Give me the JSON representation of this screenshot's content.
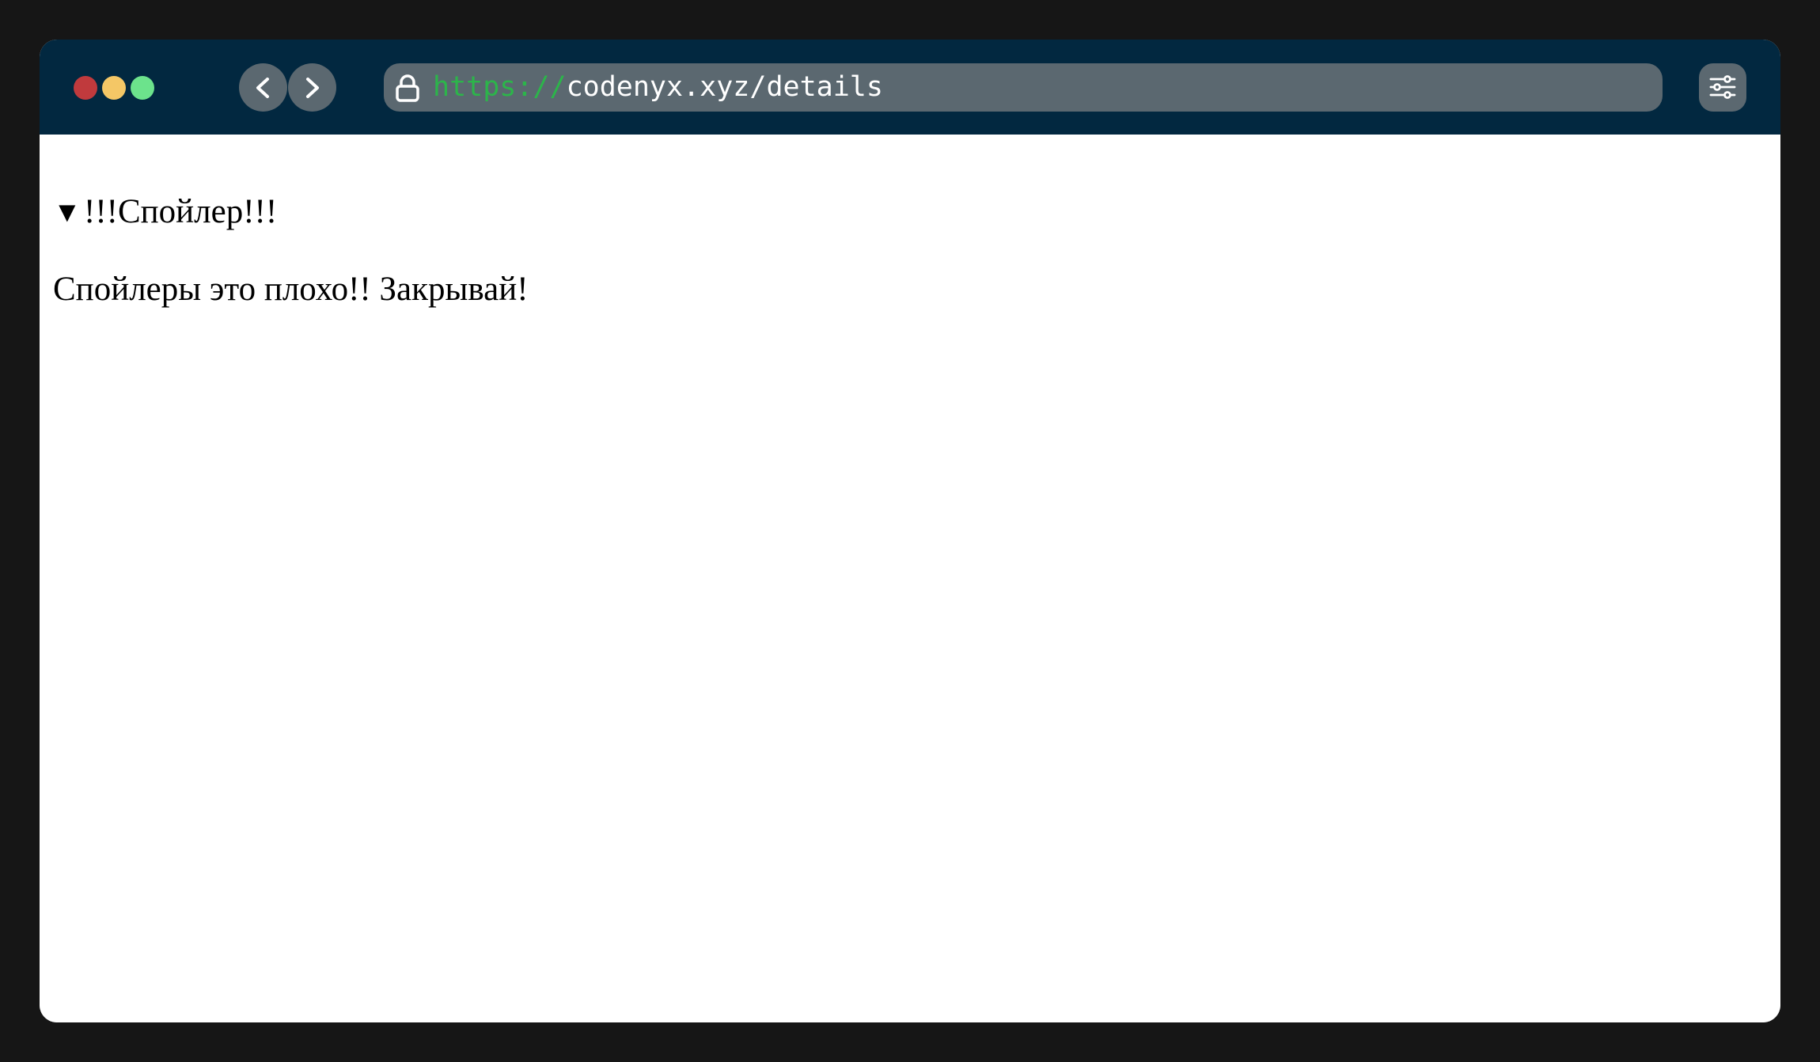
{
  "browser": {
    "url_scheme": "https://",
    "url_rest": "codenyx.xyz/details",
    "colors": {
      "toolbar": "#022840",
      "control": "#5b6870",
      "scheme_text": "#2cb54a",
      "close_dot": "#c03a3d",
      "minimize_dot": "#f4c766",
      "maximize_dot": "#6ce38c"
    },
    "icons": [
      "chevron-left-icon",
      "chevron-right-icon",
      "lock-icon",
      "sliders-icon"
    ]
  },
  "page": {
    "details": {
      "open": true,
      "marker": "▼",
      "summary": "!!!Спойлер!!!",
      "content": "Спойлеры это плохо!! Закрывай!"
    }
  }
}
